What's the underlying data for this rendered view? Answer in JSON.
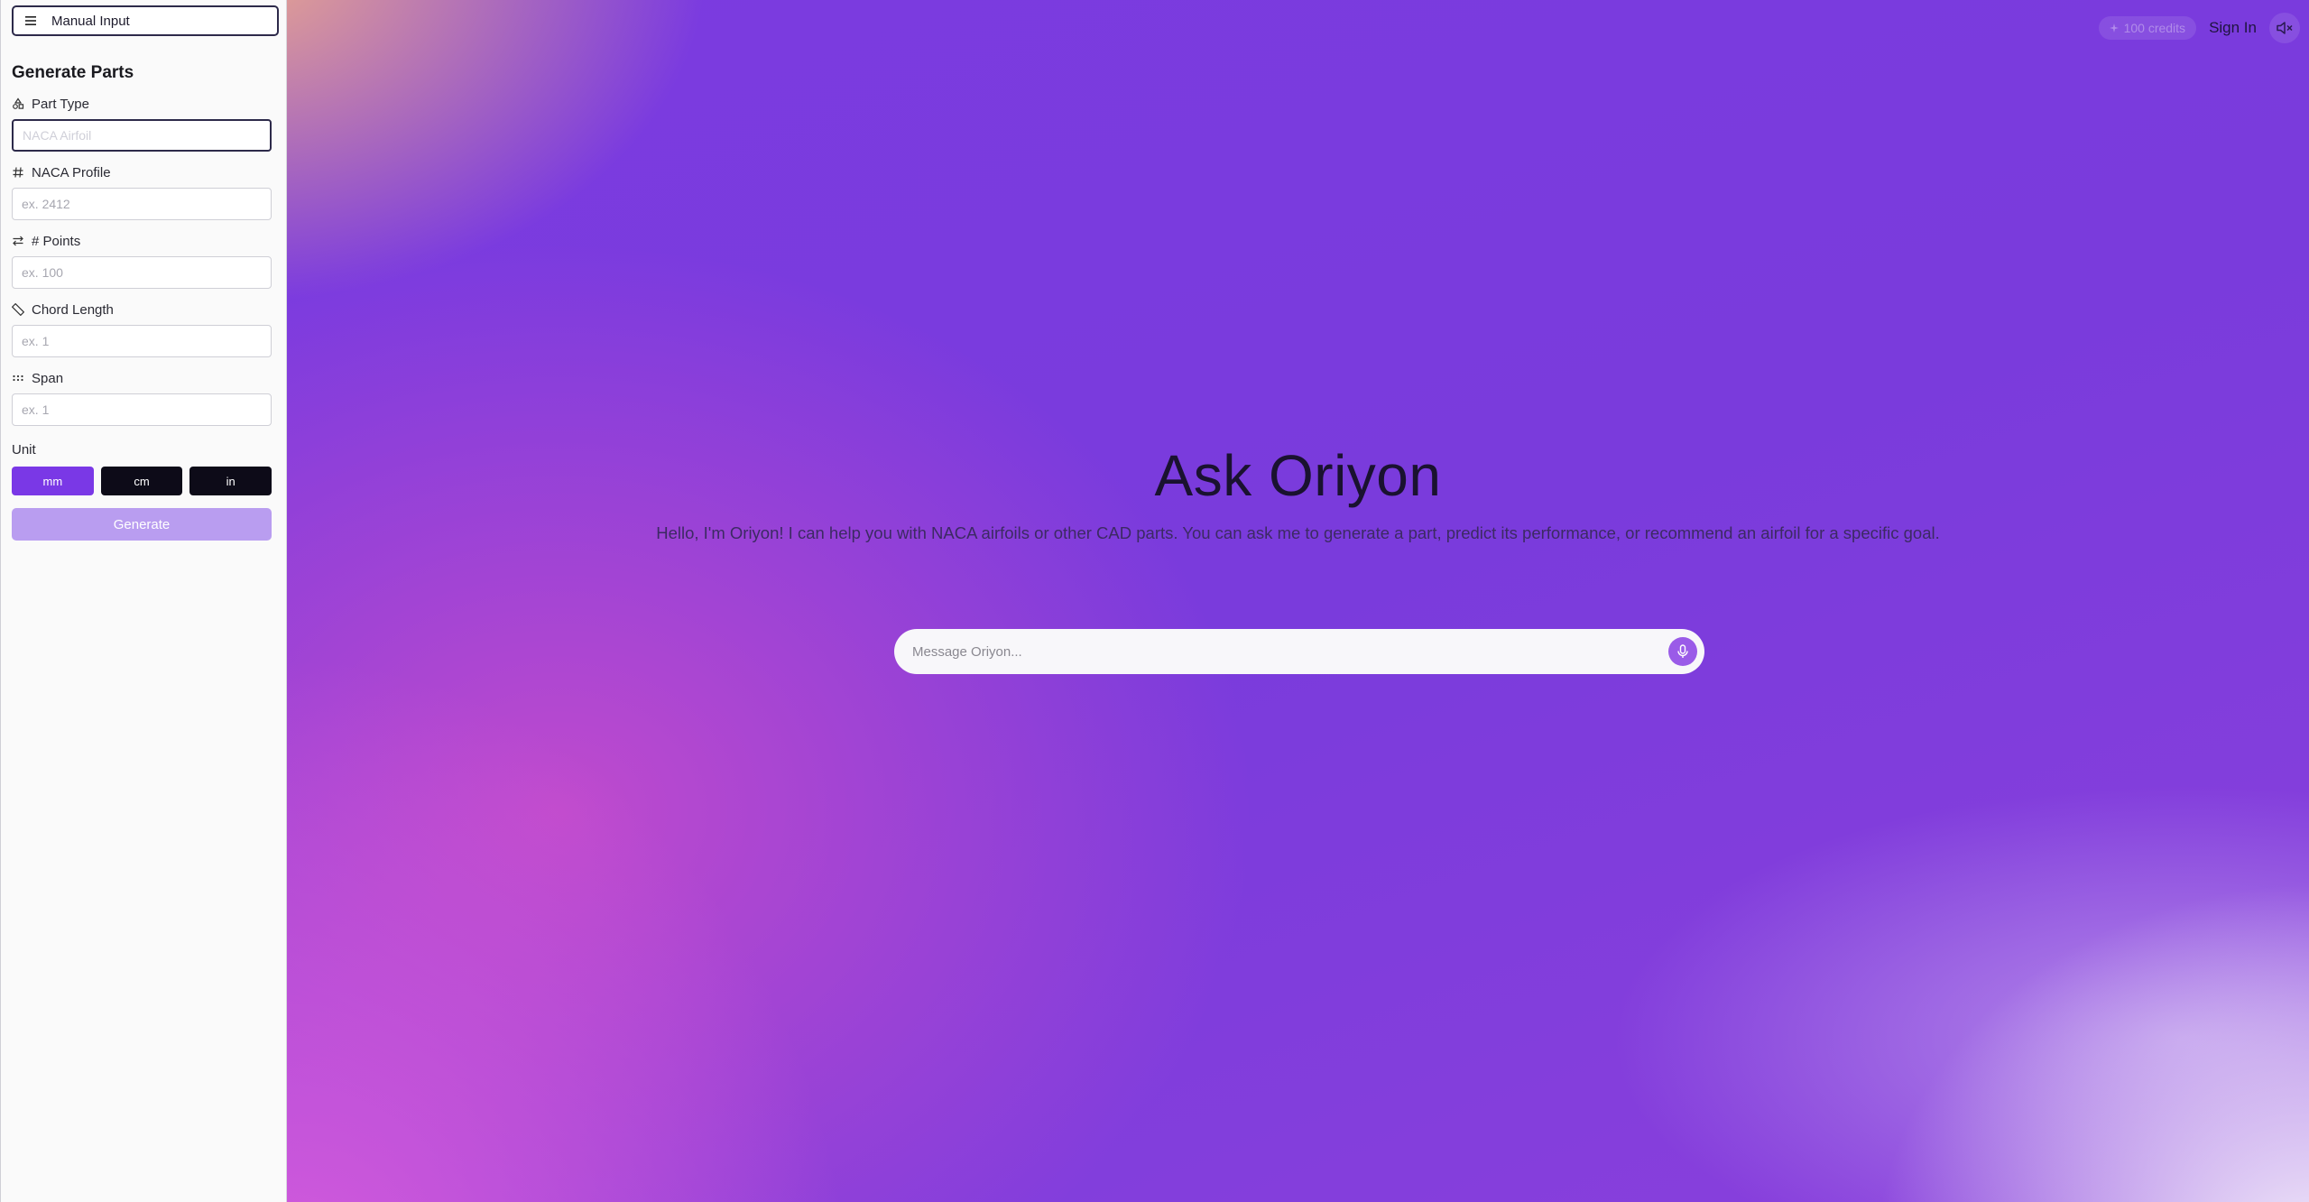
{
  "sidebar": {
    "mode_toggle_label": "Manual Input",
    "section_title": "Generate Parts",
    "fields": {
      "part_type": {
        "label": "Part Type",
        "placeholder": "NACA Airfoil"
      },
      "naca_profile": {
        "label": "NACA Profile",
        "placeholder": "ex. 2412"
      },
      "points": {
        "label": "# Points",
        "placeholder": "ex. 100"
      },
      "chord_length": {
        "label": "Chord Length",
        "placeholder": "ex. 1"
      },
      "span": {
        "label": "Span",
        "placeholder": "ex. 1"
      }
    },
    "unit": {
      "label": "Unit",
      "options": [
        "mm",
        "cm",
        "in"
      ],
      "selected": "mm"
    },
    "generate_label": "Generate"
  },
  "topbar": {
    "credits": "100 credits",
    "signin_label": "Sign In"
  },
  "hero": {
    "title": "Ask Oriyon",
    "subtitle": "Hello, I'm Oriyon! I can help you with NACA airfoils or other CAD parts. You can ask me to generate a part, predict its performance, or recommend an airfoil for a specific goal."
  },
  "chat": {
    "placeholder": "Message Oriyon..."
  },
  "colors": {
    "accent": "#7a38e6",
    "unit_inactive": "#0d0b18",
    "generate_disabled": "#b99df0",
    "mic": "#9a5be8"
  },
  "icons": {
    "menu": "menu-icon",
    "part_type": "shapes-icon",
    "naca_profile": "hash-icon",
    "points": "arrows-left-right-icon",
    "chord_length": "ruler-icon",
    "span": "grip-icon",
    "credits": "sparkle-icon",
    "mute": "volume-mute-icon",
    "mic": "microphone-icon"
  }
}
